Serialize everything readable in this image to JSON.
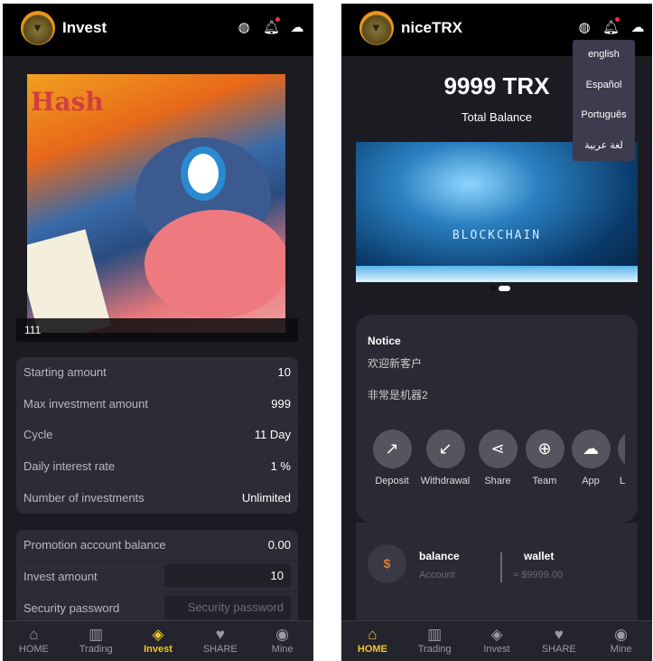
{
  "invest_screen": {
    "header": {
      "title": "Invest",
      "icons": [
        "language-icon",
        "bell-icon",
        "support-icon"
      ]
    },
    "product": {
      "caption": "111",
      "image_text": "Hash"
    },
    "details": [
      {
        "label": "Starting amount",
        "value": "10"
      },
      {
        "label": "Max investment amount",
        "value": "999"
      },
      {
        "label": "Cycle",
        "value": "11 Day"
      },
      {
        "label": "Daily interest rate",
        "value": "1 %"
      },
      {
        "label": "Number of investments",
        "value": "Unlimited"
      }
    ],
    "form": {
      "promotion_label": "Promotion account balance",
      "promotion_value": "0.00",
      "amount_label": "Invest amount",
      "amount_value": "10",
      "password_label": "Security password",
      "password_placeholder": "Security password"
    }
  },
  "home_screen": {
    "header": {
      "title": "niceTRX"
    },
    "language_menu": [
      "english",
      "Español",
      "Português",
      "لغة عربية"
    ],
    "balance": {
      "amount": "9999 TRX",
      "label": "Total Balance"
    },
    "banner": {
      "text": "BLOCKCHAIN",
      "slide": 2,
      "slides": 2
    },
    "notice": {
      "title": "Notice",
      "lines": [
        "欢迎新客户",
        "非常是机器2"
      ]
    },
    "actions": [
      {
        "label": "Deposit",
        "icon": "arrow-up-right-icon"
      },
      {
        "label": "Withdrawal",
        "icon": "arrow-down-left-icon"
      },
      {
        "label": "Share",
        "icon": "share-icon"
      },
      {
        "label": "Team",
        "icon": "globe-icon"
      },
      {
        "label": "App",
        "icon": "cloud-download-icon"
      },
      {
        "label": "L",
        "icon": "more-icon"
      }
    ],
    "account": {
      "title": "balance",
      "subtitle": "Account",
      "wallet_title": "wallet",
      "wallet_value": "≈ $9999.00"
    }
  },
  "nav": [
    {
      "label": "HOME"
    },
    {
      "label": "Trading"
    },
    {
      "label": "Invest"
    },
    {
      "label": "SHARE"
    },
    {
      "label": "Mine"
    }
  ],
  "colors": {
    "accent": "#f0c52a",
    "background": "#1b1b21",
    "card": "#2c2c37"
  }
}
